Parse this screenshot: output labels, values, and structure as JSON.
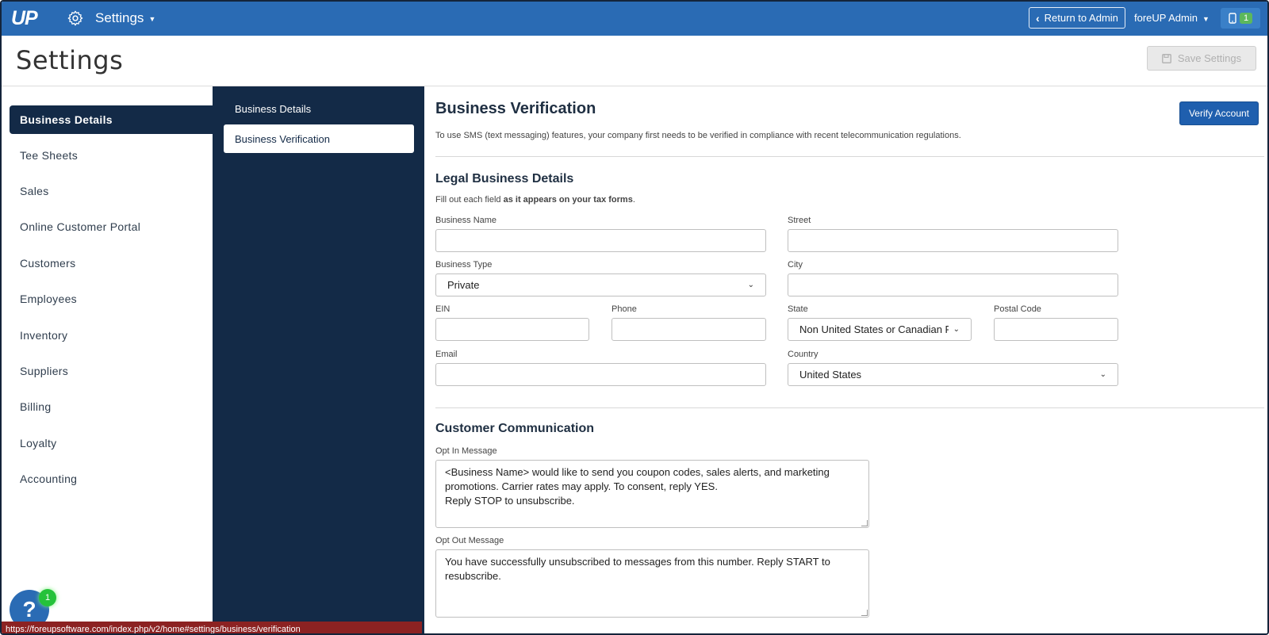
{
  "topbar": {
    "logo": "UP",
    "app_menu_label": "Settings",
    "return_label": "Return to Admin",
    "user_label": "foreUP Admin",
    "notification_count": "1"
  },
  "header": {
    "title": "Settings",
    "save_label": "Save Settings"
  },
  "left_nav": {
    "items": [
      {
        "label": "Business Details"
      },
      {
        "label": "Tee Sheets"
      },
      {
        "label": "Sales"
      },
      {
        "label": "Online Customer Portal"
      },
      {
        "label": "Customers"
      },
      {
        "label": "Employees"
      },
      {
        "label": "Inventory"
      },
      {
        "label": "Suppliers"
      },
      {
        "label": "Billing"
      },
      {
        "label": "Loyalty"
      },
      {
        "label": "Accounting"
      }
    ]
  },
  "sub_nav": {
    "items": [
      {
        "label": "Business Details"
      },
      {
        "label": "Business Verification"
      }
    ]
  },
  "verification": {
    "title": "Business Verification",
    "description": "To use SMS (text messaging) features, your company first needs to be verified in compliance with recent telecommunication regulations.",
    "verify_label": "Verify Account"
  },
  "legal": {
    "title": "Legal Business Details",
    "hint_prefix": "Fill out each field ",
    "hint_bold": "as it appears on your tax forms",
    "hint_suffix": ".",
    "fields": {
      "business_name": {
        "label": "Business Name",
        "value": ""
      },
      "street": {
        "label": "Street",
        "value": ""
      },
      "business_type": {
        "label": "Business Type",
        "value": "Private"
      },
      "city": {
        "label": "City",
        "value": ""
      },
      "ein": {
        "label": "EIN",
        "value": ""
      },
      "phone": {
        "label": "Phone",
        "value": ""
      },
      "state": {
        "label": "State",
        "value": "Non United States or Canadian Re"
      },
      "postal_code": {
        "label": "Postal Code",
        "value": ""
      },
      "email": {
        "label": "Email",
        "value": ""
      },
      "country": {
        "label": "Country",
        "value": "United States"
      }
    }
  },
  "communication": {
    "title": "Customer Communication",
    "opt_in_label": "Opt In Message",
    "opt_in_value": "<Business Name> would like to send you coupon codes, sales alerts, and marketing\npromotions. Carrier rates may apply. To consent, reply YES.\nReply STOP to unsubscribe.",
    "opt_out_label": "Opt Out Message",
    "opt_out_value": "You have successfully unsubscribed to messages from this number. Reply START to\nresubscribe."
  },
  "help": {
    "symbol": "?",
    "badge_count": "1"
  },
  "status_bar": {
    "url": "https://foreupsoftware.com/index.php/v2/home#settings/business/verification"
  },
  "colors": {
    "topbar": "#2a6bb4",
    "nav_dark": "#132a47",
    "primary_button": "#1f5fae",
    "badge_green": "#25c23a"
  }
}
